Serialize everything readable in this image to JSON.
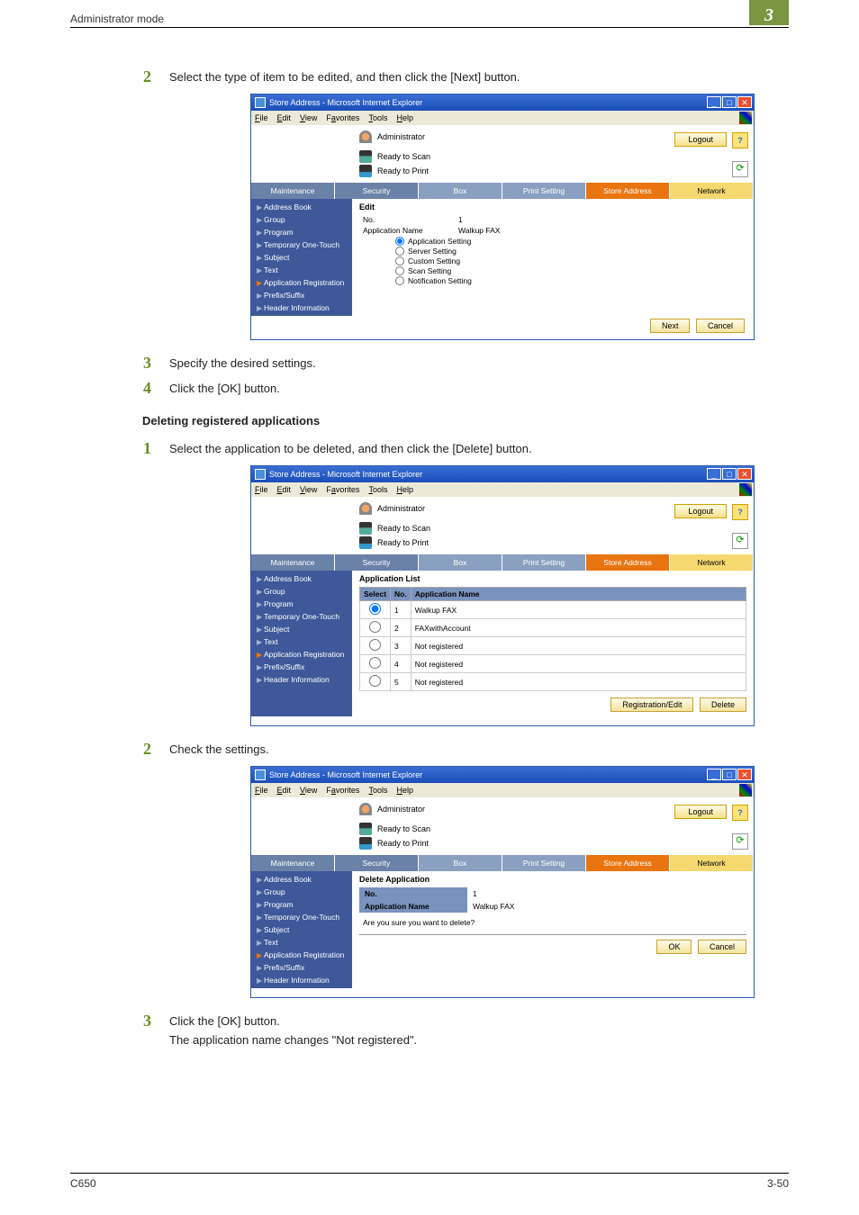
{
  "header": {
    "section": "Administrator mode",
    "chapter": "3"
  },
  "steps_a": {
    "s2": "Select the type of item to be edited, and then click the [Next] button.",
    "s3": "Specify the desired settings.",
    "s4": "Click the [OK] button."
  },
  "heading_delete": "Deleting registered applications",
  "steps_b": {
    "s1": "Select the application to be deleted, and then click the [Delete] button.",
    "s2": "Check the settings.",
    "s3a": "Click the [OK] button.",
    "s3b": "The application name changes \"Not registered\"."
  },
  "browser": {
    "title": "Store Address - Microsoft Internet Explorer",
    "menus": {
      "file": "File",
      "edit": "Edit",
      "view": "View",
      "fav": "Favorites",
      "tools": "Tools",
      "help": "Help"
    }
  },
  "app_header": {
    "user": "Administrator",
    "scan": "Ready to Scan",
    "print": "Ready to Print",
    "logout": "Logout",
    "help": "?",
    "refresh": "⟳"
  },
  "tabs": {
    "maintenance": "Maintenance",
    "security": "Security",
    "box": "Box",
    "print": "Print Setting",
    "store": "Store Address",
    "network": "Network"
  },
  "sidebar": {
    "items": [
      "Address Book",
      "Group",
      "Program",
      "Temporary One-Touch",
      "Subject",
      "Text",
      "Application Registration",
      "Prefix/Suffix",
      "Header Information"
    ]
  },
  "panel_edit": {
    "title": "Edit",
    "no_lbl": "No.",
    "no_val": "1",
    "appname_lbl": "Application Name",
    "appname_val": "Walkup FAX",
    "radios": [
      "Application Setting",
      "Server Setting",
      "Custom Setting",
      "Scan Setting",
      "Notification Setting"
    ],
    "next": "Next",
    "cancel": "Cancel"
  },
  "panel_list": {
    "title": "Application List",
    "cols": {
      "select": "Select",
      "no": "No.",
      "name": "Application Name"
    },
    "rows": [
      {
        "no": "1",
        "name": "Walkup FAX"
      },
      {
        "no": "2",
        "name": "FAXwithAccount"
      },
      {
        "no": "3",
        "name": "Not registered"
      },
      {
        "no": "4",
        "name": "Not registered"
      },
      {
        "no": "5",
        "name": "Not registered"
      }
    ],
    "reg_edit": "Registration/Edit",
    "delete": "Delete"
  },
  "panel_delete": {
    "title": "Delete Application",
    "no_lbl": "No.",
    "no_val": "1",
    "name_lbl": "Application Name",
    "name_val": "Walkup FAX",
    "confirm": "Are you sure you want to delete?",
    "ok": "OK",
    "cancel": "Cancel"
  },
  "footer": {
    "left": "C650",
    "right": "3-50"
  }
}
